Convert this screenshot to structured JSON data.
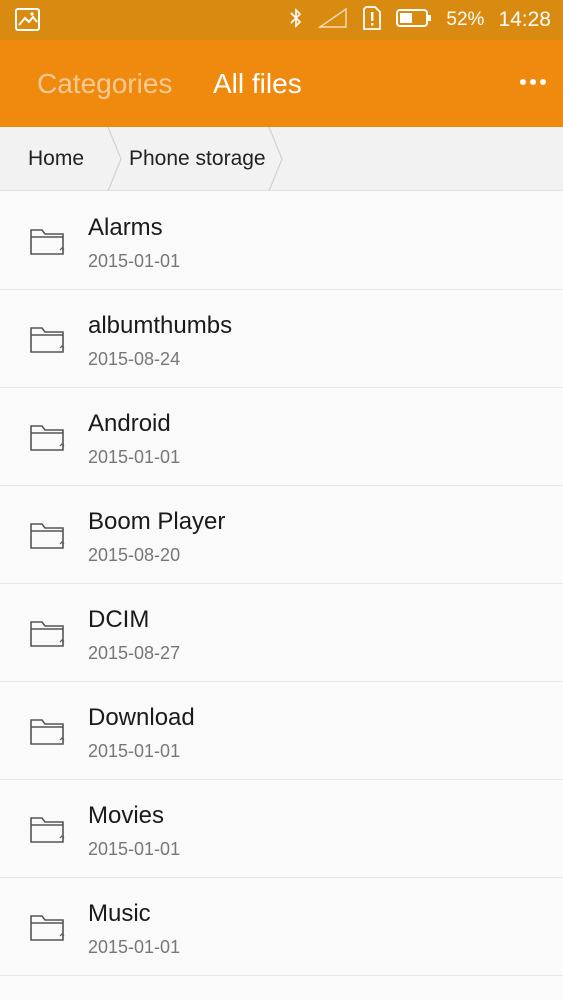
{
  "status_bar": {
    "battery_percent": "52%",
    "time": "14:28",
    "icons": [
      "gallery-icon",
      "bluetooth-icon",
      "signal-icon",
      "sim-alert-icon",
      "battery-icon"
    ],
    "battery_level": 0.52
  },
  "toolbar": {
    "tabs": [
      {
        "label": "Categories",
        "active": false
      },
      {
        "label": "All files",
        "active": true
      }
    ],
    "more_icon": "more-dots-icon",
    "accent_color": "#f08a0f"
  },
  "breadcrumb": {
    "items": [
      "Home",
      "Phone storage"
    ]
  },
  "files": [
    {
      "name": "Alarms",
      "date": "2015-01-01"
    },
    {
      "name": "albumthumbs",
      "date": "2015-08-24"
    },
    {
      "name": "Android",
      "date": "2015-01-01"
    },
    {
      "name": "Boom Player",
      "date": "2015-08-20"
    },
    {
      "name": "DCIM",
      "date": "2015-08-27"
    },
    {
      "name": "Download",
      "date": "2015-01-01"
    },
    {
      "name": "Movies",
      "date": "2015-01-01"
    },
    {
      "name": "Music",
      "date": "2015-01-01"
    }
  ]
}
